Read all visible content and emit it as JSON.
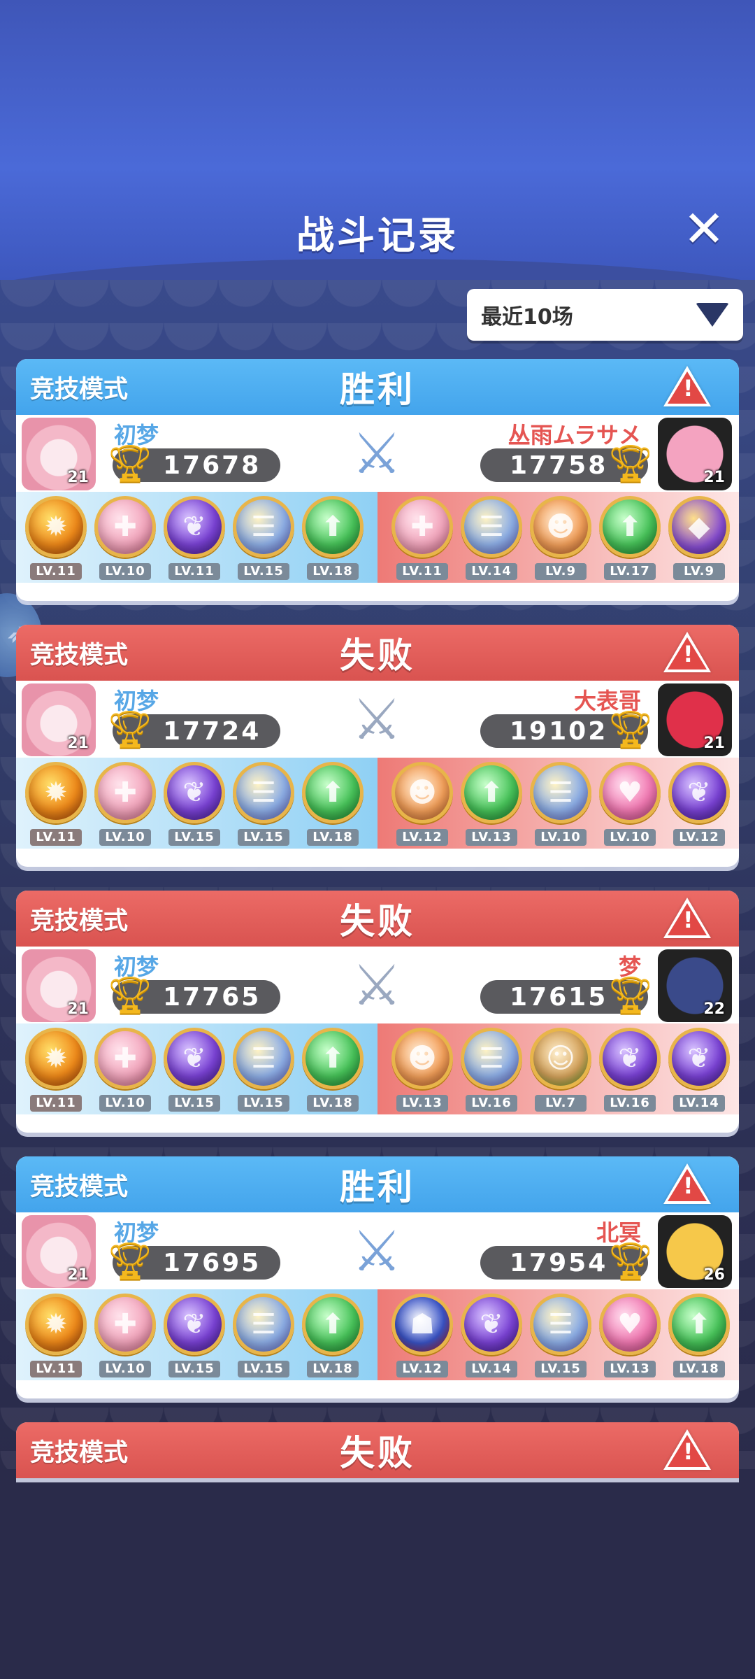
{
  "header": {
    "title": "战斗记录",
    "close_label": "✕"
  },
  "filter": {
    "label": "最近10场"
  },
  "matches": [
    {
      "mode": "竞技模式",
      "result": "胜利",
      "result_type": "win",
      "me": {
        "name": "初梦",
        "score": "17678",
        "level": "21",
        "heroes": [
          {
            "orb": "fire",
            "lv": "LV.11"
          },
          {
            "orb": "pink",
            "lv": "LV.10"
          },
          {
            "orb": "purple",
            "lv": "LV.11"
          },
          {
            "orb": "rainbow",
            "lv": "LV.15"
          },
          {
            "orb": "green",
            "lv": "LV.18"
          }
        ]
      },
      "opp": {
        "name": "丛雨ムラサメ",
        "score": "17758",
        "level": "21",
        "heroes": [
          {
            "orb": "pink",
            "lv": "LV.11"
          },
          {
            "orb": "rainbow",
            "lv": "LV.14"
          },
          {
            "orb": "monkey",
            "lv": "LV.9"
          },
          {
            "orb": "green",
            "lv": "LV.17"
          },
          {
            "orb": "dino",
            "lv": "LV.9"
          }
        ]
      }
    },
    {
      "mode": "竞技模式",
      "result": "失败",
      "result_type": "lose",
      "me": {
        "name": "初梦",
        "score": "17724",
        "level": "21",
        "heroes": [
          {
            "orb": "fire",
            "lv": "LV.11"
          },
          {
            "orb": "pink",
            "lv": "LV.10"
          },
          {
            "orb": "purple",
            "lv": "LV.15"
          },
          {
            "orb": "rainbow",
            "lv": "LV.15"
          },
          {
            "orb": "green",
            "lv": "LV.18"
          }
        ]
      },
      "opp": {
        "name": "大表哥",
        "score": "19102",
        "level": "21",
        "heroes": [
          {
            "orb": "monkey",
            "lv": "LV.12"
          },
          {
            "orb": "green",
            "lv": "LV.13"
          },
          {
            "orb": "rainbow",
            "lv": "LV.10"
          },
          {
            "orb": "heart",
            "lv": "LV.10"
          },
          {
            "orb": "purple",
            "lv": "LV.12"
          }
        ]
      }
    },
    {
      "mode": "竞技模式",
      "result": "失败",
      "result_type": "lose",
      "me": {
        "name": "初梦",
        "score": "17765",
        "level": "21",
        "heroes": [
          {
            "orb": "fire",
            "lv": "LV.11"
          },
          {
            "orb": "pink",
            "lv": "LV.10"
          },
          {
            "orb": "purple",
            "lv": "LV.15"
          },
          {
            "orb": "rainbow",
            "lv": "LV.15"
          },
          {
            "orb": "green",
            "lv": "LV.18"
          }
        ]
      },
      "opp": {
        "name": "梦",
        "score": "17615",
        "level": "22",
        "heroes": [
          {
            "orb": "monkey",
            "lv": "LV.13"
          },
          {
            "orb": "rainbow",
            "lv": "LV.16"
          },
          {
            "orb": "ape",
            "lv": "LV.7"
          },
          {
            "orb": "purple",
            "lv": "LV.16"
          },
          {
            "orb": "purple",
            "lv": "LV.14"
          }
        ]
      }
    },
    {
      "mode": "竞技模式",
      "result": "胜利",
      "result_type": "win",
      "me": {
        "name": "初梦",
        "score": "17695",
        "level": "21",
        "heroes": [
          {
            "orb": "fire",
            "lv": "LV.11"
          },
          {
            "orb": "pink",
            "lv": "LV.10"
          },
          {
            "orb": "purple",
            "lv": "LV.15"
          },
          {
            "orb": "rainbow",
            "lv": "LV.15"
          },
          {
            "orb": "green",
            "lv": "LV.18"
          }
        ]
      },
      "opp": {
        "name": "北冥",
        "score": "17954",
        "level": "26",
        "heroes": [
          {
            "orb": "mask",
            "lv": "LV.12"
          },
          {
            "orb": "purple",
            "lv": "LV.14"
          },
          {
            "orb": "rainbow",
            "lv": "LV.15"
          },
          {
            "orb": "heart",
            "lv": "LV.13"
          },
          {
            "orb": "green",
            "lv": "LV.18"
          }
        ]
      }
    },
    {
      "mode": "竞技模式",
      "result": "失败",
      "result_type": "lose"
    }
  ],
  "colors": {
    "win": "#43a4ec",
    "lose": "#d95350",
    "accent_gold": "#f4b81e"
  }
}
